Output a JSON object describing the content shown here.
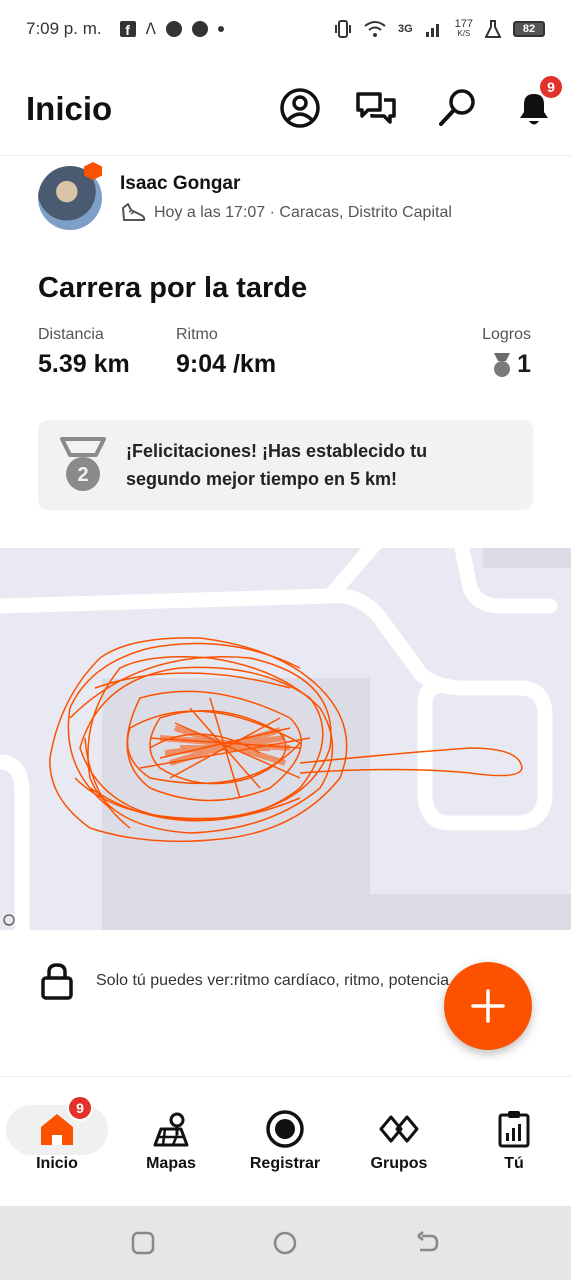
{
  "status_bar": {
    "time": "7:09 p. m.",
    "net_speed_top": "177",
    "net_speed_bottom": "K/S",
    "network": "3G",
    "battery": "82"
  },
  "header": {
    "title": "Inicio",
    "notifications_count": "9"
  },
  "post": {
    "author": "Isaac Gongar",
    "meta": "Hoy a las 17:07 · Caracas, Distrito Capital",
    "title": "Carrera por la tarde",
    "stats": {
      "distance_label": "Distancia",
      "distance_value": "5.39 km",
      "pace_label": "Ritmo",
      "pace_value": "9:04 /km",
      "achievements_label": "Logros",
      "achievements_value": "1"
    },
    "congrats": {
      "medal_number": "2",
      "text": "¡Felicitaciones! ¡Has establecido tu segundo mejor tiempo en 5 km!"
    },
    "privacy_text": "Solo tú puedes ver:ritmo cardíaco, ritmo, potencia"
  },
  "bottom_nav": {
    "items": [
      {
        "label": "Inicio",
        "badge": "9"
      },
      {
        "label": "Mapas"
      },
      {
        "label": "Registrar"
      },
      {
        "label": "Grupos"
      },
      {
        "label": "Tú"
      }
    ]
  },
  "colors": {
    "accent": "#fc5200",
    "badge": "#e3322b",
    "route": "#fc5200"
  }
}
